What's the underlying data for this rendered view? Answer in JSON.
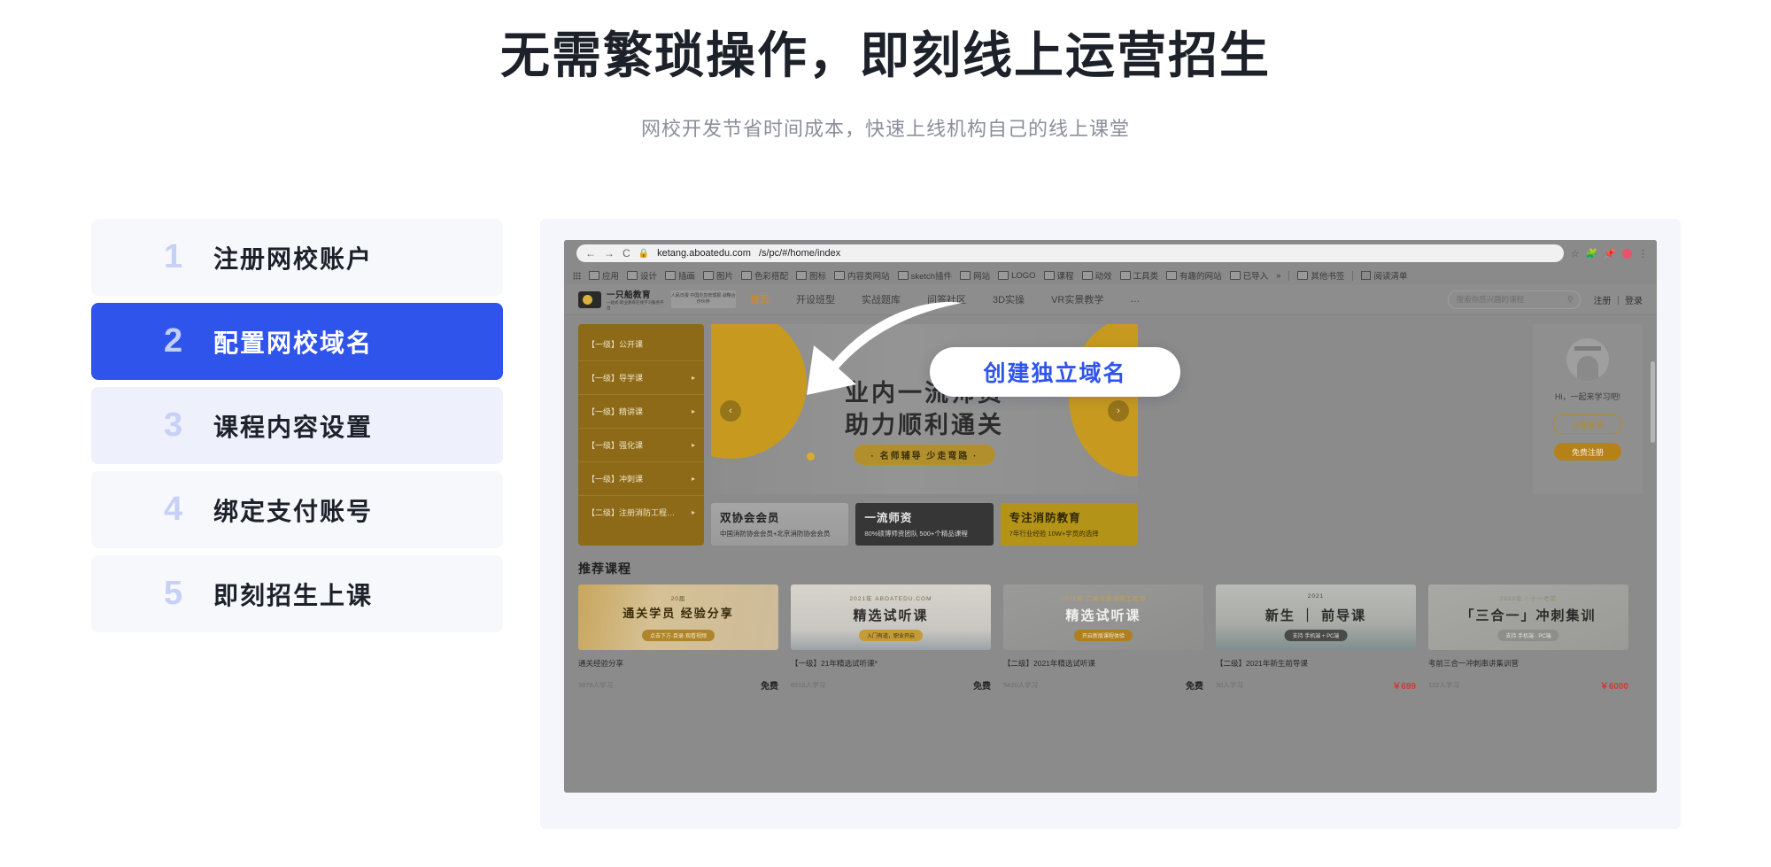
{
  "hero": {
    "title": "无需繁琐操作，即刻线上运营招生",
    "subtitle": "网校开发节省时间成本，快速上线机构自己的线上课堂"
  },
  "steps": [
    {
      "num": "1",
      "label": "注册网校账户",
      "active": false
    },
    {
      "num": "2",
      "label": "配置网校域名",
      "active": true
    },
    {
      "num": "3",
      "label": "课程内容设置",
      "active": false
    },
    {
      "num": "4",
      "label": "绑定支付账号",
      "active": false
    },
    {
      "num": "5",
      "label": "即刻招生上课",
      "active": false
    }
  ],
  "callout": {
    "label": "创建独立域名",
    "color": "#2f54eb"
  },
  "browser": {
    "back_icon": "←",
    "forward_icon": "→",
    "reload_icon": "C",
    "lock_icon": "🔒",
    "url_domain": "ketang.aboatedu.com",
    "url_path": "/s/pc/#/home/index",
    "star_icon": "☆",
    "extension_icon": "puzzle-icon",
    "pin_icon": "pin-icon",
    "profile_icon": "profile-icon",
    "menu_icon": "⋮",
    "bookmarks": [
      "应用",
      "设计",
      "插画",
      "图片",
      "色彩搭配",
      "图标",
      "内容类网站",
      "sketch插件",
      "网站",
      "LOGO",
      "课程",
      "动效",
      "工具类",
      "有趣的网站",
      "已导入"
    ],
    "overflow_label": "»",
    "other_bookmarks": "其他书签",
    "reading_list": "阅读清单"
  },
  "site": {
    "logo_name": "一只船教育",
    "logo_tagline": "一站式·职业教育在线学习服务平台",
    "logo_badge": "人民日报 中国应急管理报 战略合作伙伴",
    "menu": [
      {
        "label": "首页",
        "active": true
      },
      {
        "label": "开设班型",
        "active": false
      },
      {
        "label": "实战题库",
        "active": false
      },
      {
        "label": "问答社区",
        "active": false
      },
      {
        "label": "3D实操",
        "active": false
      },
      {
        "label": "VR实景教学",
        "active": false
      },
      {
        "label": "…",
        "active": false
      }
    ],
    "search_placeholder": "搜索你感兴趣的课程",
    "auth": "注册 ｜ 登录",
    "categories": [
      {
        "label": "【一级】公开课",
        "arrow": false
      },
      {
        "label": "【一级】导学课",
        "arrow": true
      },
      {
        "label": "【一级】精讲课",
        "arrow": true
      },
      {
        "label": "【一级】强化课",
        "arrow": true
      },
      {
        "label": "【一级】冲刺课",
        "arrow": true
      },
      {
        "label": "【二级】注册消防工程…",
        "arrow": true
      }
    ],
    "banner": {
      "line1": "业内一流师资",
      "line2": "助力顺利通关",
      "pill": "· 名师辅导 少走弯路 ·",
      "prev_icon": "‹",
      "next_icon": "›"
    },
    "user_panel": {
      "greeting": "Hi，一起来学习吧!",
      "login": "立即登录",
      "register": "免费注册"
    },
    "features": [
      {
        "title": "双协会会员",
        "desc": "中国消防协会会员+北京消防协会会员"
      },
      {
        "title": "一流师资",
        "desc": "80%硕博师资团队 500+个精品课程"
      },
      {
        "title": "专注消防教育",
        "desc": "7年行业经验  10W+学员的选择"
      }
    ],
    "recommend_title": "推荐课程",
    "courses": [
      {
        "name": "通关经验分享",
        "learners": "3878人学习",
        "price": "免费",
        "paid": false,
        "thumb_top": "20届",
        "thumb_main": "通关学员 经验分享",
        "thumb_sub": "点击下方·目录·观看视频"
      },
      {
        "name": "【一级】21年精选试听课*",
        "learners": "6516人学习",
        "price": "免费",
        "paid": false,
        "thumb_top": "2021年 ABOATEDU.COM",
        "thumb_main": "精选试听课",
        "thumb_sub": "入门有道，职业开启"
      },
      {
        "name": "【二级】2021年精选试听课",
        "learners": "5420人学习",
        "price": "免费",
        "paid": false,
        "thumb_top": "2021年  二级注册消防工程师",
        "thumb_main": "精选试听课",
        "thumb_sub": "开启新版课程体验"
      },
      {
        "name": "【二级】2021年新生前导课",
        "learners": "30人学习",
        "price": "￥699",
        "paid": true,
        "thumb_top": "2021",
        "thumb_main": "新生 ｜ 前导课",
        "thumb_sub": "支持 手机端 + PC端"
      },
      {
        "name": "考前三合一冲刺串讲集训营",
        "learners": "122人学习",
        "price": "￥6000",
        "paid": true,
        "thumb_top": "2020年 / 十一考前",
        "thumb_main": "「三合一」冲刺集训",
        "thumb_sub": "支持 手机端 · PC端"
      }
    ]
  }
}
